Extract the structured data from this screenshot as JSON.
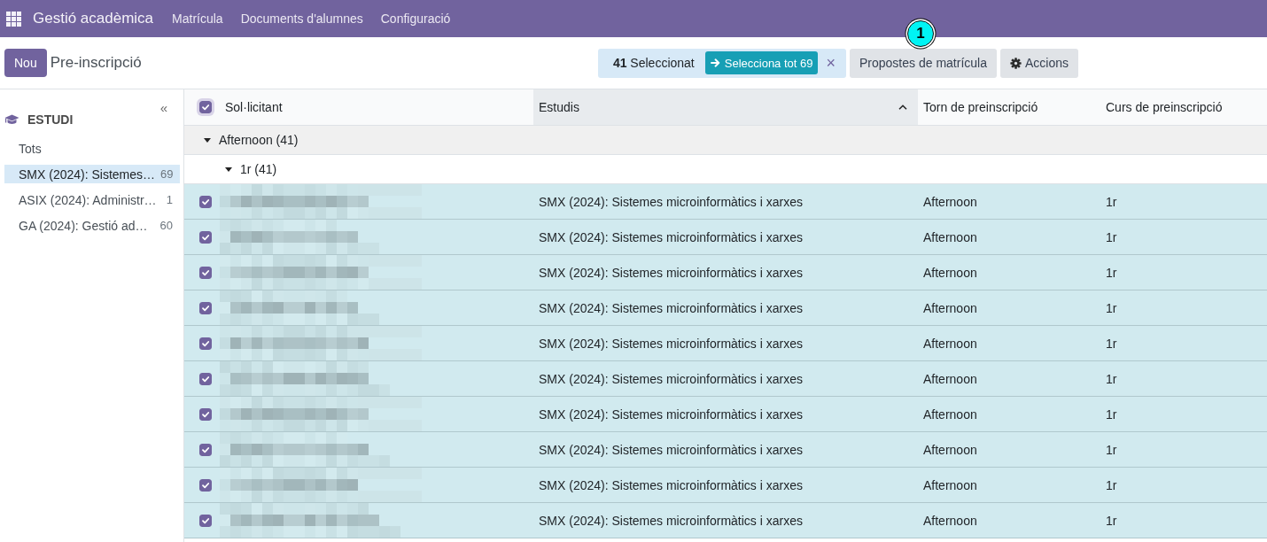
{
  "navbar": {
    "app_title": "Gestió acadèmica",
    "menu": [
      "Matrícula",
      "Documents d'alumnes",
      "Configuració"
    ]
  },
  "control_panel": {
    "new_button": "Nou",
    "breadcrumb": "Pre-inscripció",
    "selection": {
      "text": "**41** Seleccionat",
      "select_all": "Selecciona tot 69",
      "clear": "×"
    },
    "buttons": [
      {
        "label": "Propostes de matrícula",
        "kind": "plain"
      },
      {
        "label": "Accions",
        "kind": "actions"
      }
    ]
  },
  "callout": {
    "label": "1"
  },
  "sidebar": {
    "collapse": "«",
    "title": "ESTUDI",
    "items": [
      {
        "label": "Tots",
        "selected": false
      },
      {
        "label": "SMX (2024): Sistemes…",
        "count": "69",
        "selected": true
      },
      {
        "label": "ASIX (2024): Administr…",
        "count": "1",
        "selected": false
      },
      {
        "label": "GA (2024): Gestió ad…",
        "count": "60",
        "selected": false
      }
    ]
  },
  "table": {
    "select_all_checked": true,
    "columns": [
      {
        "label": "Sol·licitant",
        "sorted": false
      },
      {
        "label": "Estudis",
        "sorted": true
      },
      {
        "label": "Torn de preinscripció",
        "sorted": false
      },
      {
        "label": "Curs de preinscripció",
        "sorted": false
      }
    ],
    "groups": [
      {
        "label": "Afternoon (41)",
        "expanded": true,
        "children": [
          {
            "label": "1r (41)",
            "expanded": true,
            "rows": [
              {
                "selected": true,
                "checked": true,
                "studies": "SMX (2024): Sistemes microinformàtics i xarxes",
                "shift": "Afternoon",
                "course": "1r"
              },
              {
                "selected": true,
                "checked": true,
                "studies": "SMX (2024): Sistemes microinformàtics i xarxes",
                "shift": "Afternoon",
                "course": "1r"
              },
              {
                "selected": true,
                "checked": true,
                "studies": "SMX (2024): Sistemes microinformàtics i xarxes",
                "shift": "Afternoon",
                "course": "1r"
              },
              {
                "selected": true,
                "checked": true,
                "studies": "SMX (2024): Sistemes microinformàtics i xarxes",
                "shift": "Afternoon",
                "course": "1r"
              },
              {
                "selected": true,
                "checked": true,
                "studies": "SMX (2024): Sistemes microinformàtics i xarxes",
                "shift": "Afternoon",
                "course": "1r"
              },
              {
                "selected": true,
                "checked": true,
                "studies": "SMX (2024): Sistemes microinformàtics i xarxes",
                "shift": "Afternoon",
                "course": "1r"
              },
              {
                "selected": true,
                "checked": true,
                "studies": "SMX (2024): Sistemes microinformàtics i xarxes",
                "shift": "Afternoon",
                "course": "1r"
              },
              {
                "selected": true,
                "checked": true,
                "studies": "SMX (2024): Sistemes microinformàtics i xarxes",
                "shift": "Afternoon",
                "course": "1r"
              },
              {
                "selected": true,
                "checked": true,
                "studies": "SMX (2024): Sistemes microinformàtics i xarxes",
                "shift": "Afternoon",
                "course": "1r"
              },
              {
                "selected": true,
                "checked": true,
                "studies": "SMX (2024): Sistemes microinformàtics i xarxes",
                "shift": "Afternoon",
                "course": "1r"
              }
            ]
          }
        ]
      }
    ]
  }
}
